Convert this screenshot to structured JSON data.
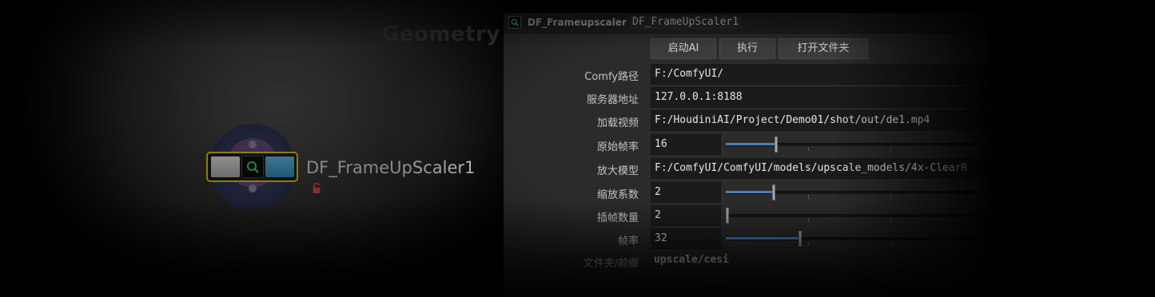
{
  "network": {
    "watermark": "Geometry",
    "node": {
      "label": "DF_FrameUpScaler1",
      "icon": "search-icon",
      "flag_icon": "lock-open-icon",
      "border_color": "#d8c300"
    }
  },
  "param_pane": {
    "node_type": "DF_Frameupscaler",
    "node_name": "DF_FrameUpScaler1",
    "buttons": [
      "启动AI",
      "执行",
      "打开文件夹"
    ],
    "params": [
      {
        "label": "Comfy路径",
        "value": "F:/ComfyUI/"
      },
      {
        "label": "服务器地址",
        "value": "127.0.0.1:8188"
      },
      {
        "label": "加载视频",
        "value": "F:/HoudiniAI/Project/Demo01/shot/out/de1.mp4"
      },
      {
        "label": "原始帧率",
        "value": "16",
        "slider_fraction": 0.19
      },
      {
        "label": "放大模型",
        "value": "F:/ComfyUI/ComfyUI/models/upscale_models/4x-ClearR"
      },
      {
        "label": "缩放系数",
        "value": "2",
        "slider_fraction": 0.18
      },
      {
        "label": "插帧数量",
        "value": "2",
        "slider_fraction": 0.0
      },
      {
        "label": "帧率",
        "value": "32",
        "slider_fraction": 0.28
      },
      {
        "label": "文件夹/前缀",
        "value": "upscale/cesi"
      }
    ]
  },
  "colors": {
    "accent_slider": "#4b7fb4",
    "node_selected": "#d8c300",
    "background": "#2b2b2b"
  }
}
